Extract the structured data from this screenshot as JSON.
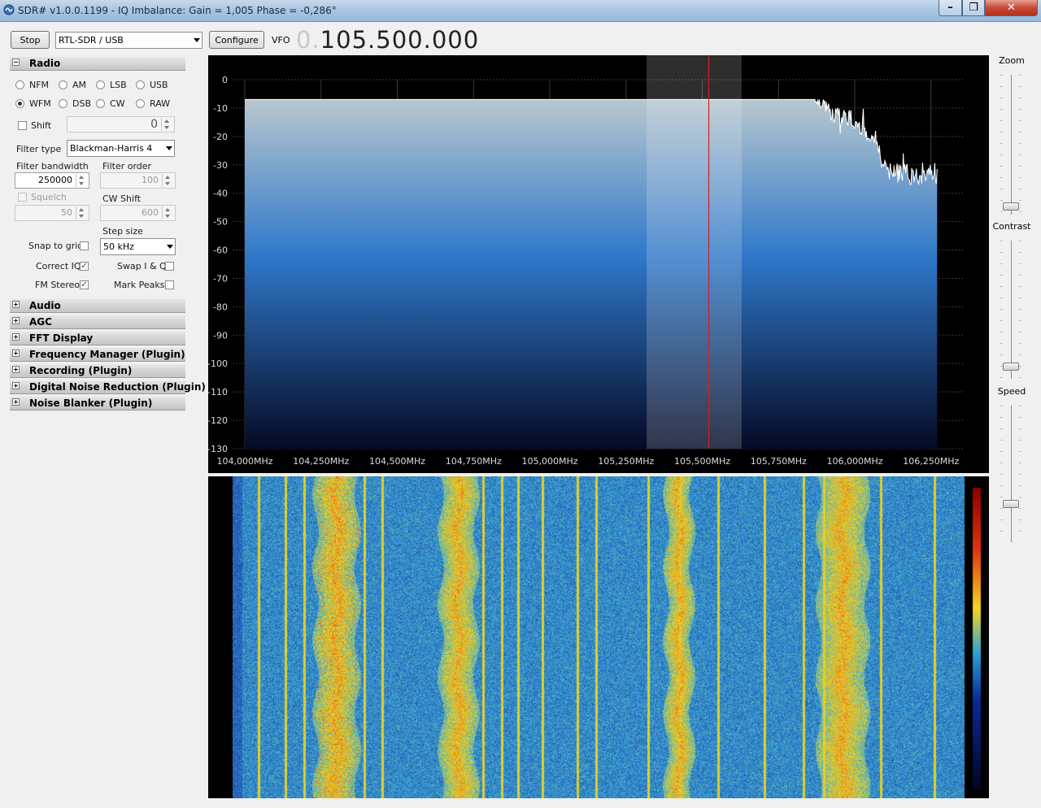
{
  "window": {
    "title": "SDR# v1.0.0.1199 - IQ Imbalance: Gain = 1,005 Phase = -0,286°",
    "minimize_glyph": "–",
    "maximize_glyph": "❐",
    "close_glyph": "✕"
  },
  "toolbar": {
    "stop_label": "Stop",
    "device": "RTL-SDR / USB",
    "configure_label": "Configure",
    "vfo_label": "VFO",
    "vfo_dim": "0.",
    "vfo_value": "105.500.000"
  },
  "radio_panel": {
    "title": "Radio",
    "collapse_glyph": "−",
    "modes": [
      {
        "label": "NFM",
        "selected": false
      },
      {
        "label": "AM",
        "selected": false
      },
      {
        "label": "LSB",
        "selected": false
      },
      {
        "label": "USB",
        "selected": false
      },
      {
        "label": "WFM",
        "selected": true
      },
      {
        "label": "DSB",
        "selected": false
      },
      {
        "label": "CW",
        "selected": false
      },
      {
        "label": "RAW",
        "selected": false
      }
    ],
    "shift_label": "Shift",
    "shift_value": "0",
    "filter_type_label": "Filter type",
    "filter_type_value": "Blackman-Harris 4",
    "filter_bandwidth_label": "Filter bandwidth",
    "filter_bandwidth_value": "250000",
    "filter_order_label": "Filter order",
    "filter_order_value": "100",
    "squelch_label": "Squelch",
    "squelch_value": "50",
    "cw_shift_label": "CW Shift",
    "cw_shift_value": "600",
    "step_size_label": "Step size",
    "step_size_value": "50 kHz",
    "snap_to_grid_label": "Snap to grid",
    "correct_iq_label": "Correct IQ",
    "swap_iq_label": "Swap I & Q",
    "fm_stereo_label": "FM Stereo",
    "mark_peaks_label": "Mark Peaks",
    "check_glyph": "✓"
  },
  "collapsed_panels": {
    "expand_glyph": "+",
    "items": [
      "Audio",
      "AGC",
      "FFT Display",
      "Frequency Manager (Plugin)",
      "Recording (Plugin)",
      "Digital Noise Reduction (Plugin)",
      "Noise Blanker (Plugin)"
    ]
  },
  "right_sliders": {
    "zoom_label": "Zoom",
    "contrast_label": "Contrast",
    "speed_label": "Speed"
  },
  "chart_data": {
    "type": "area",
    "y_ticks": [
      "0",
      "-10",
      "-20",
      "-30",
      "-40",
      "-50",
      "-60",
      "-70",
      "-80",
      "-90",
      "-100",
      "-110",
      "-120",
      "-130"
    ],
    "ylim": [
      -130,
      0
    ],
    "x_ticks": [
      "104,000MHz",
      "104,250MHz",
      "104,500MHz",
      "104,750MHz",
      "105,000MHz",
      "105,250MHz",
      "105,500MHz",
      "105,750MHz",
      "106,000MHz",
      "106,250MHz"
    ],
    "xlim_mhz": [
      103.96,
      106.36
    ],
    "noise_floor_db": -33,
    "peaks": [
      {
        "freq_mhz": 104.3,
        "level_db": -10
      },
      {
        "freq_mhz": 104.7,
        "level_db": -15
      },
      {
        "freq_mhz": 105.45,
        "level_db": -17
      },
      {
        "freq_mhz": 105.96,
        "level_db": -13
      }
    ],
    "tuned_freq_mhz": 105.5,
    "filter_bandwidth_hz": 250000,
    "colors": {
      "trace": "#ffffff",
      "fill_top": "#b7c7cf",
      "fill_mid": "#2f78c9",
      "fill_bottom": "#050a24",
      "vfo_line": "#d22020",
      "grid": "#3a3a3a"
    }
  },
  "waterfall": {
    "colors": {
      "low": "#1f4fb0",
      "mid": "#38a6d8",
      "high": "#f2d21a",
      "peak": "#e83a14"
    }
  }
}
